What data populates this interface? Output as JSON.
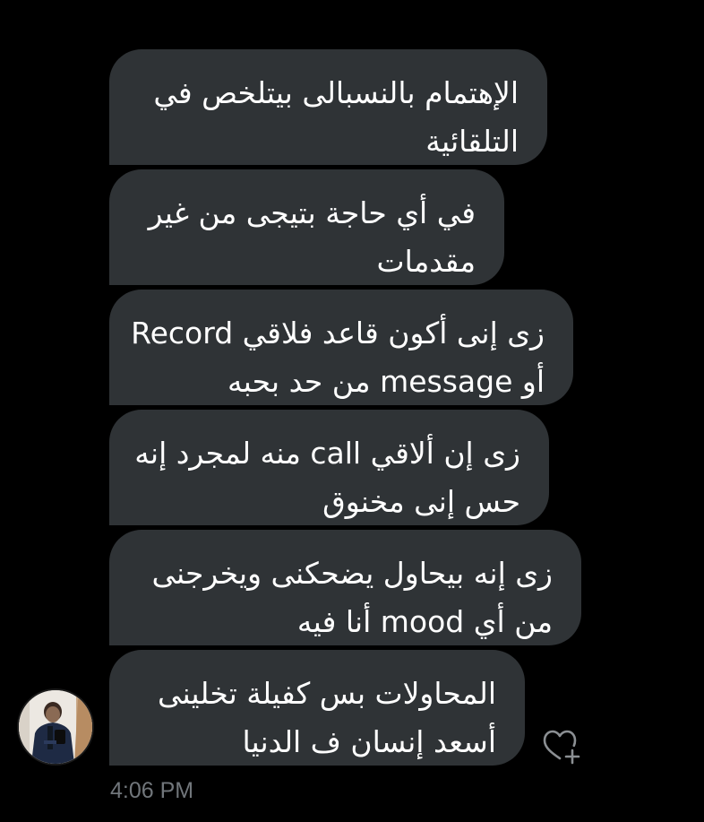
{
  "conversation": {
    "messages": [
      {
        "lines": [
          "الإهتمام بالنسبالى بيتلخص في",
          "التلقائية"
        ]
      },
      {
        "lines": [
          "في أي حاجة بتيجى من غير",
          "مقدمات"
        ]
      },
      {
        "lines": [
          "زى إنى أكون قاعد فلاقي Record",
          "أو message من حد بحبه"
        ]
      },
      {
        "lines": [
          "زى إن ألاقي call منه لمجرد إنه",
          "حس إنى مخنوق"
        ]
      },
      {
        "lines": [
          "زى إنه بيحاول يضحكنى ويخرجنى",
          "من أي mood أنا فيه"
        ]
      },
      {
        "lines": [
          "المحاولات بس كفيلة تخلينى",
          "أسعد إنسان ف الدنيا"
        ]
      }
    ],
    "timestamp": "4:06 PM",
    "avatar_icon": "user-avatar",
    "reaction_icon": "heart-plus-icon"
  },
  "colors": {
    "background": "#000000",
    "bubble": "#2f3336",
    "text": "#ffffff",
    "timestamp": "#71767b"
  }
}
